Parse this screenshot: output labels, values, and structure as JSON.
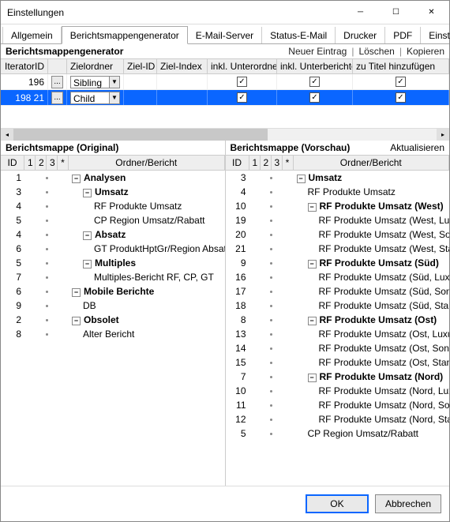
{
  "window": {
    "title": "Einstellungen"
  },
  "tabs": {
    "items": [
      "Allgemein",
      "Berichtsmappengenerator",
      "E-Mail-Server",
      "Status-E-Mail",
      "Drucker",
      "PDF",
      "Einstellun"
    ],
    "active": 1
  },
  "section": {
    "title": "Berichtsmappengenerator",
    "actions": {
      "new": "Neuer Eintrag",
      "delete": "Löschen",
      "copy": "Kopieren"
    }
  },
  "grid": {
    "headers": [
      "IteratorID",
      "",
      "Zielordner",
      "Ziel-ID",
      "Ziel-Index",
      "inkl. Unterordner",
      "inkl. Unterberichte",
      "zu Titel hinzufügen"
    ],
    "rows": [
      {
        "id": "196",
        "btn": "...",
        "folder": "Sibling",
        "zielId": "",
        "zielIndex": "",
        "unterordner": true,
        "unterberichte": true,
        "titel": true,
        "selected": false
      },
      {
        "id": "198 21",
        "btn": "...",
        "folder": "Child",
        "zielId": "",
        "zielIndex": "",
        "unterordner": true,
        "unterberichte": true,
        "titel": true,
        "selected": true
      }
    ]
  },
  "original": {
    "title": "Berichtsmappe (Original)",
    "headers": {
      "id": "ID",
      "c1": "1",
      "c2": "2",
      "c3": "3",
      "star": "*",
      "name": "Ordner/Bericht"
    },
    "rows": [
      {
        "id": "1",
        "name": "Analysen",
        "bold": true,
        "exp": "−",
        "indent": 0
      },
      {
        "id": "3",
        "name": "Umsatz",
        "bold": true,
        "exp": "−",
        "indent": 1
      },
      {
        "id": "4",
        "name": "RF Produkte Umsatz",
        "bold": false,
        "indent": 2
      },
      {
        "id": "5",
        "name": "CP Region Umsatz/Rabatt",
        "bold": false,
        "indent": 2
      },
      {
        "id": "4",
        "name": "Absatz",
        "bold": true,
        "exp": "−",
        "indent": 1
      },
      {
        "id": "6",
        "name": "GT ProduktHptGr/Region Absatz",
        "bold": false,
        "indent": 2
      },
      {
        "id": "5",
        "name": "Multiples",
        "bold": true,
        "exp": "−",
        "indent": 1
      },
      {
        "id": "7",
        "name": "Multiples-Bericht RF, CP, GT",
        "bold": false,
        "indent": 2
      },
      {
        "id": "6",
        "name": "Mobile Berichte",
        "bold": true,
        "exp": "−",
        "indent": 0
      },
      {
        "id": "9",
        "name": "DB",
        "bold": false,
        "indent": 1
      },
      {
        "id": "2",
        "name": "Obsolet",
        "bold": true,
        "exp": "−",
        "indent": 0
      },
      {
        "id": "8",
        "name": "Alter Bericht",
        "bold": false,
        "indent": 1
      }
    ]
  },
  "preview": {
    "title": "Berichtsmappe (Vorschau)",
    "action": "Aktualisieren",
    "headers": {
      "id": "ID",
      "c1": "1",
      "c2": "2",
      "c3": "3",
      "star": "*",
      "name": "Ordner/Bericht"
    },
    "rows": [
      {
        "id": "3",
        "name": "Umsatz",
        "bold": true,
        "exp": "−",
        "indent": 0
      },
      {
        "id": "4",
        "name": "RF Produkte Umsatz",
        "bold": false,
        "indent": 1
      },
      {
        "id": "10",
        "name": "RF Produkte Umsatz (West)",
        "bold": true,
        "exp": "−",
        "indent": 1
      },
      {
        "id": "19",
        "name": "RF Produkte Umsatz (West, Luxusmodelle)",
        "bold": false,
        "indent": 2
      },
      {
        "id": "20",
        "name": "RF Produkte Umsatz (West, Sondermodelle)",
        "bold": false,
        "indent": 2
      },
      {
        "id": "21",
        "name": "RF Produkte Umsatz (West, Standardmodelle)",
        "bold": false,
        "indent": 2
      },
      {
        "id": "9",
        "name": "RF Produkte Umsatz (Süd)",
        "bold": true,
        "exp": "−",
        "indent": 1
      },
      {
        "id": "16",
        "name": "RF Produkte Umsatz (Süd, Luxusmodelle)",
        "bold": false,
        "indent": 2
      },
      {
        "id": "17",
        "name": "RF Produkte Umsatz (Süd, Sondermodelle)",
        "bold": false,
        "indent": 2
      },
      {
        "id": "18",
        "name": "RF Produkte Umsatz (Süd, Standardmodelle)",
        "bold": false,
        "indent": 2
      },
      {
        "id": "8",
        "name": "RF Produkte Umsatz (Ost)",
        "bold": true,
        "exp": "−",
        "indent": 1
      },
      {
        "id": "13",
        "name": "RF Produkte Umsatz (Ost, Luxusmodelle)",
        "bold": false,
        "indent": 2
      },
      {
        "id": "14",
        "name": "RF Produkte Umsatz (Ost, Sondermodelle)",
        "bold": false,
        "indent": 2
      },
      {
        "id": "15",
        "name": "RF Produkte Umsatz (Ost, Standardmodelle)",
        "bold": false,
        "indent": 2
      },
      {
        "id": "7",
        "name": "RF Produkte Umsatz (Nord)",
        "bold": true,
        "exp": "−",
        "indent": 1
      },
      {
        "id": "10",
        "name": "RF Produkte Umsatz (Nord, Luxusmodelle)",
        "bold": false,
        "indent": 2
      },
      {
        "id": "11",
        "name": "RF Produkte Umsatz (Nord, Sondermodelle)",
        "bold": false,
        "indent": 2
      },
      {
        "id": "12",
        "name": "RF Produkte Umsatz (Nord, Standardmodelle)",
        "bold": false,
        "indent": 2
      },
      {
        "id": "5",
        "name": "CP Region Umsatz/Rabatt",
        "bold": false,
        "indent": 1
      }
    ]
  },
  "buttons": {
    "ok": "OK",
    "cancel": "Abbrechen"
  }
}
